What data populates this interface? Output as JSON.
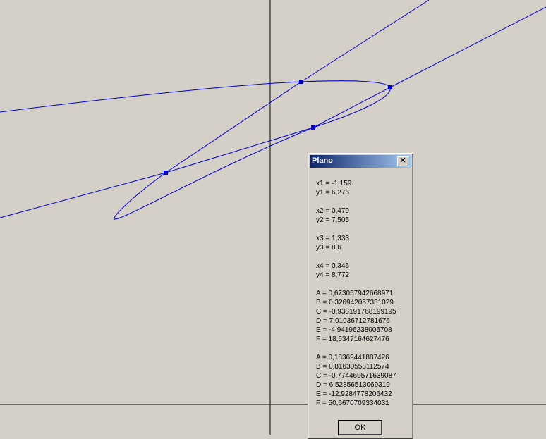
{
  "canvas": {
    "background": "#d4d0c8",
    "axis_color": "#000000",
    "curve_color": "#0000cc"
  },
  "dialog": {
    "title": "Plano",
    "close_glyph": "✕",
    "ok_label": "OK",
    "groups": [
      [
        "x1 = -1,159",
        "y1 = 6,276"
      ],
      [
        "x2 = 0,479",
        "y2 = 7,505"
      ],
      [
        "x3 = 1,333",
        "y3 = 8,6"
      ],
      [
        "x4 = 0,346",
        "y4 = 8,772"
      ],
      [
        "A = 0,673057942668971",
        "B = 0,326942057331029",
        "C = -0,938191768199195",
        "D = 7,01036712781676",
        "E = -4,94196238005708",
        "F = 18,5347164627476"
      ],
      [
        "A = 0,18369441887426",
        "B = 0,81630558112574",
        "C = -0,774469571639087",
        "D = 6,52356513069319",
        "E = -12,9284778206432",
        "F = 50,6670709334031"
      ]
    ]
  }
}
